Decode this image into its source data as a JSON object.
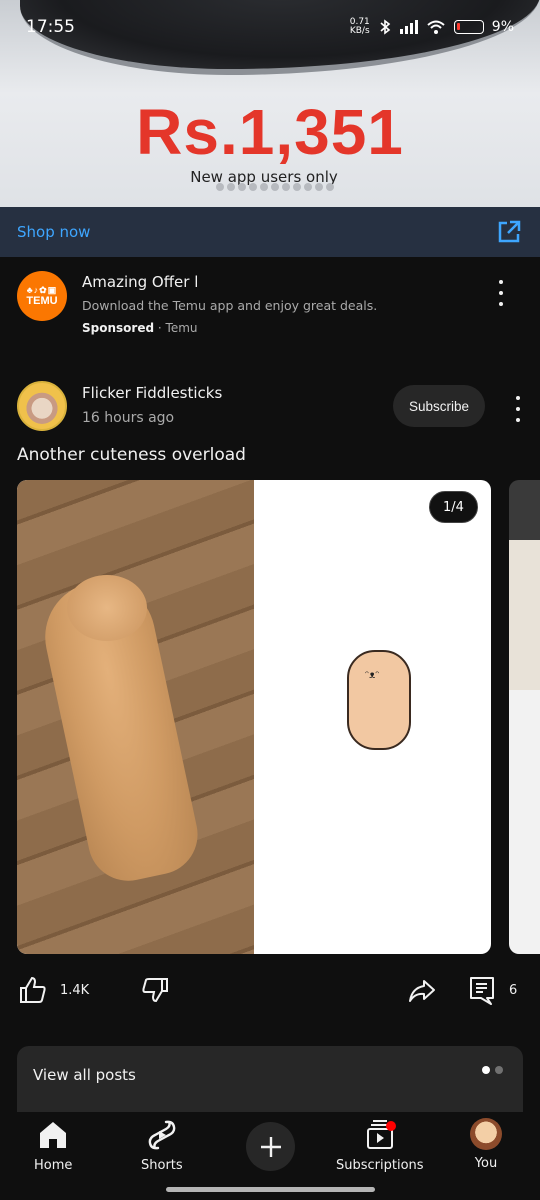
{
  "status_bar": {
    "time": "17:55",
    "net_speed_value": "0.71",
    "net_speed_unit": "KB/s",
    "battery": "9%"
  },
  "ad": {
    "price": "Rs.1,351",
    "subtitle": "New app users only",
    "cta": "Shop now",
    "slide_count": 11,
    "colors": {
      "price": "#e4362a",
      "cta_bar": "#263041",
      "cta_text": "#3ea6ff"
    }
  },
  "sponsored": {
    "logo_text": "TEMU",
    "title": "Amazing Offer l",
    "description": "Download the Temu app and enjoy great deals.",
    "label": "Sponsored",
    "separator": "·",
    "advertiser": "Temu",
    "brand_color": "#fb7701"
  },
  "post": {
    "channel": "Flicker Fiddlesticks",
    "time": "16 hours ago",
    "subscribe_label": "Subscribe",
    "text": "Another cuteness overload",
    "image_counter": "1/4",
    "likes": "1.4K",
    "comments": "6"
  },
  "view_all": {
    "label": "View all posts",
    "active_page": 1,
    "page_count": 2
  },
  "nav": {
    "home": "Home",
    "shorts": "Shorts",
    "subscriptions": "Subscriptions",
    "you": "You",
    "subscriptions_badge_color": "#ff0000"
  }
}
